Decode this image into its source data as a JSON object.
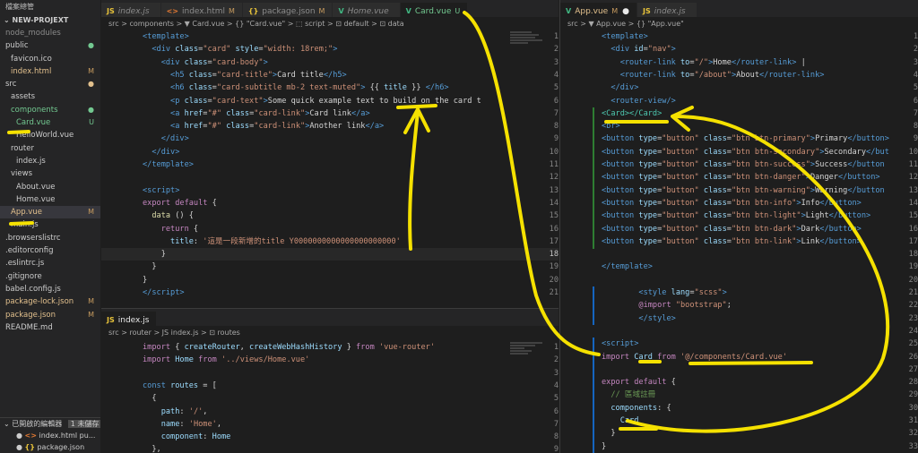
{
  "explorer": {
    "title": "檔案總管",
    "project": "NEW-PROJEXT",
    "items": [
      {
        "label": "node_modules",
        "indent": 1,
        "color": "#8b8b8b",
        "status": ""
      },
      {
        "label": "public",
        "indent": 1,
        "color": "#cccccc",
        "status": "●",
        "stcolor": "#73c991"
      },
      {
        "label": "favicon.ico",
        "indent": 2,
        "color": "#cccccc",
        "status": ""
      },
      {
        "label": "index.html",
        "indent": 2,
        "color": "#e2c08d",
        "status": "M"
      },
      {
        "label": "src",
        "indent": 1,
        "color": "#cccccc",
        "status": "●",
        "stcolor": "#e2c08d"
      },
      {
        "label": "assets",
        "indent": 2,
        "color": "#cccccc",
        "status": ""
      },
      {
        "label": "components",
        "indent": 2,
        "color": "#73c991",
        "status": "●",
        "stcolor": "#73c991"
      },
      {
        "label": "Card.vue",
        "indent": 3,
        "color": "#73c991",
        "status": "U",
        "stcolor": "#73c991"
      },
      {
        "label": "HelloWorld.vue",
        "indent": 3,
        "color": "#cccccc",
        "status": ""
      },
      {
        "label": "router",
        "indent": 2,
        "color": "#cccccc",
        "status": ""
      },
      {
        "label": "index.js",
        "indent": 3,
        "color": "#cccccc",
        "status": ""
      },
      {
        "label": "views",
        "indent": 2,
        "color": "#cccccc",
        "status": ""
      },
      {
        "label": "About.vue",
        "indent": 3,
        "color": "#cccccc",
        "status": ""
      },
      {
        "label": "Home.vue",
        "indent": 3,
        "color": "#cccccc",
        "status": ""
      },
      {
        "label": "App.vue",
        "indent": 2,
        "color": "#e2c08d",
        "status": "M"
      },
      {
        "label": "main.js",
        "indent": 2,
        "color": "#cccccc",
        "status": ""
      },
      {
        "label": ".browserslistrc",
        "indent": 1,
        "color": "#cccccc",
        "status": ""
      },
      {
        "label": ".editorconfig",
        "indent": 1,
        "color": "#cccccc",
        "status": ""
      },
      {
        "label": ".eslintrc.js",
        "indent": 1,
        "color": "#cccccc",
        "status": ""
      },
      {
        "label": ".gitignore",
        "indent": 1,
        "color": "#cccccc",
        "status": ""
      },
      {
        "label": "babel.config.js",
        "indent": 1,
        "color": "#cccccc",
        "status": ""
      },
      {
        "label": "package-lock.json",
        "indent": 1,
        "color": "#e2c08d",
        "status": "M"
      },
      {
        "label": "package.json",
        "indent": 1,
        "color": "#e2c08d",
        "status": "M"
      },
      {
        "label": "README.md",
        "indent": 1,
        "color": "#cccccc",
        "status": ""
      }
    ],
    "open_editors": {
      "title": "已開啟的編輯器",
      "unsaved": "1 未儲存",
      "rows": [
        "index.html pu...",
        "package.json"
      ]
    }
  },
  "left_top": {
    "tabs": [
      {
        "label": "index.js",
        "badge": "",
        "icon": "JS",
        "iconColor": "#e8c33a",
        "active": false,
        "italic": true
      },
      {
        "label": "index.html",
        "badge": "M",
        "icon": "<>",
        "iconColor": "#e37933",
        "active": false,
        "italic": false
      },
      {
        "label": "package.json",
        "badge": "M",
        "icon": "{}",
        "iconColor": "#e8c33a",
        "active": false,
        "italic": false
      },
      {
        "label": "Home.vue",
        "badge": "",
        "icon": "V",
        "iconColor": "#41b883",
        "active": false,
        "italic": true
      },
      {
        "label": "Card.vue",
        "badge": "U",
        "icon": "V",
        "iconColor": "#41b883",
        "active": true,
        "italic": false
      }
    ],
    "breadcrumb": "src > components > ▼ Card.vue > {} \"Card.vue\" > ⬚ script > ⊡ default > ⊡ data"
  },
  "left_bottom": {
    "tab": {
      "label": "index.js",
      "icon": "JS"
    },
    "breadcrumb": "src > router > JS index.js > ⊡ routes"
  },
  "right": {
    "tabs": [
      {
        "label": "App.vue",
        "badge": "M",
        "icon": "V",
        "iconColor": "#41b883",
        "active": true,
        "italic": false,
        "dot": "●"
      },
      {
        "label": "index.js",
        "badge": "",
        "icon": "JS",
        "iconColor": "#e8c33a",
        "active": false,
        "italic": true
      }
    ],
    "breadcrumb": "src > ▼ App.vue > {} \"App.vue\""
  },
  "colors": {
    "accent": "#f5e100",
    "added": "#73c991",
    "modified": "#e2c08d"
  }
}
